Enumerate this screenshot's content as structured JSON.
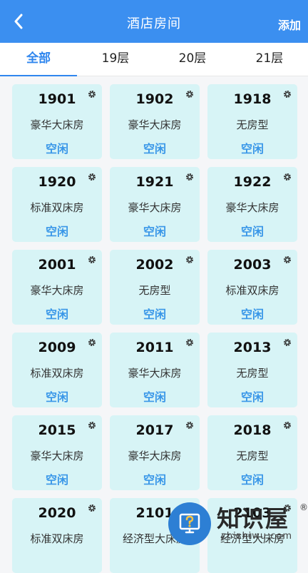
{
  "header": {
    "title": "酒店房间",
    "add_label": "添加"
  },
  "tabs": [
    {
      "label": "全部",
      "active": true
    },
    {
      "label": "19层",
      "active": false
    },
    {
      "label": "20层",
      "active": false
    },
    {
      "label": "21层",
      "active": false
    }
  ],
  "rooms": [
    {
      "number": "1901",
      "type": "豪华大床房",
      "status": "空闲"
    },
    {
      "number": "1902",
      "type": "豪华大床房",
      "status": "空闲"
    },
    {
      "number": "1918",
      "type": "无房型",
      "status": "空闲"
    },
    {
      "number": "1920",
      "type": "标准双床房",
      "status": "空闲"
    },
    {
      "number": "1921",
      "type": "豪华大床房",
      "status": "空闲"
    },
    {
      "number": "1922",
      "type": "豪华大床房",
      "status": "空闲"
    },
    {
      "number": "2001",
      "type": "豪华大床房",
      "status": "空闲"
    },
    {
      "number": "2002",
      "type": "无房型",
      "status": "空闲"
    },
    {
      "number": "2003",
      "type": "标准双床房",
      "status": "空闲"
    },
    {
      "number": "2009",
      "type": "标准双床房",
      "status": "空闲"
    },
    {
      "number": "2011",
      "type": "豪华大床房",
      "status": "空闲"
    },
    {
      "number": "2013",
      "type": "无房型",
      "status": "空闲"
    },
    {
      "number": "2015",
      "type": "豪华大床房",
      "status": "空闲"
    },
    {
      "number": "2017",
      "type": "豪华大床房",
      "status": "空闲"
    },
    {
      "number": "2018",
      "type": "无房型",
      "status": "空闲"
    },
    {
      "number": "2020",
      "type": "标准双床房",
      "status": ""
    },
    {
      "number": "2101",
      "type": "经济型大床房",
      "status": ""
    },
    {
      "number": "2103",
      "type": "经济型大床房",
      "status": ""
    }
  ],
  "watermark": {
    "brand": "知识屋",
    "reg_mark": "®",
    "url": "zhishiwu.com"
  },
  "colors": {
    "header_bg": "#3b8ff0",
    "tab_active": "#2f86ee",
    "card_bg": "#d7f4f6",
    "status_text": "#3a97e8"
  },
  "icons": {
    "back": "chevron-left-icon",
    "settings": "gear-icon",
    "watermark": "question-monitor-icon"
  }
}
